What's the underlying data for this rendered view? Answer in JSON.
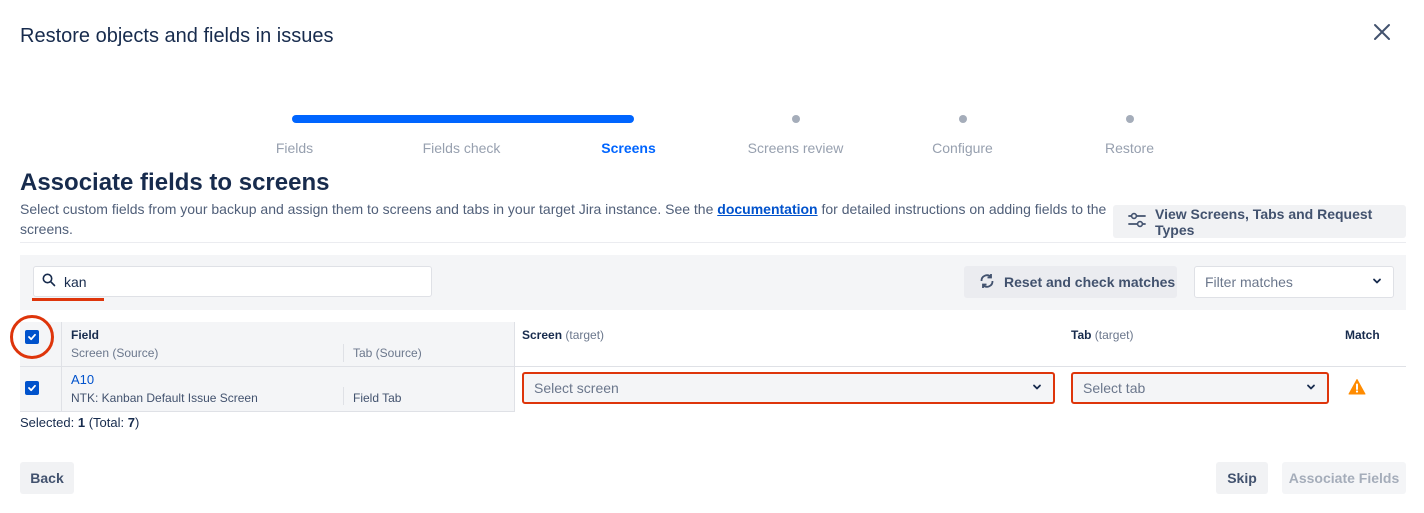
{
  "dialog": {
    "title": "Restore objects and fields in issues"
  },
  "stepper": {
    "steps": [
      {
        "label": "Fields",
        "state": "done"
      },
      {
        "label": "Fields check",
        "state": "done"
      },
      {
        "label": "Screens",
        "state": "active"
      },
      {
        "label": "Screens review",
        "state": "pending"
      },
      {
        "label": "Configure",
        "state": "pending"
      },
      {
        "label": "Restore",
        "state": "pending"
      }
    ]
  },
  "section": {
    "title": "Associate fields to screens",
    "desc_before": "Select custom fields from your backup and assign them to screens and tabs in your target Jira instance. See the ",
    "desc_link": "documentation",
    "desc_after": " for detailed instructions on adding fields to the screens.",
    "view_button": "View Screens, Tabs and Request Types"
  },
  "toolbar": {
    "search_value": "kan",
    "reset_button": "Reset and check matches",
    "filter_placeholder": "Filter matches"
  },
  "table": {
    "header": {
      "field": "Field",
      "screen_source": "Screen (Source)",
      "tab_source": "Tab (Source)",
      "screen_target": "Screen",
      "screen_target_sub": "(target)",
      "tab_target": "Tab",
      "tab_target_sub": "(target)",
      "match": "Match"
    },
    "rows": [
      {
        "field": "A10",
        "screen_source": "NTK: Kanban Default Issue Screen",
        "tab_source": "Field Tab",
        "screen_placeholder": "Select screen",
        "tab_placeholder": "Select tab",
        "match": "warning",
        "checked": true
      }
    ]
  },
  "summary": {
    "selected_label": "Selected:",
    "selected_count": "1",
    "total_label": "(Total:",
    "total_count": "7",
    "total_close": ")"
  },
  "footer": {
    "back": "Back",
    "skip": "Skip",
    "associate": "Associate Fields"
  },
  "colors": {
    "primary": "#0052cc",
    "progress": "#0065ff",
    "error": "#de350b",
    "warning": "#ff8b00"
  }
}
